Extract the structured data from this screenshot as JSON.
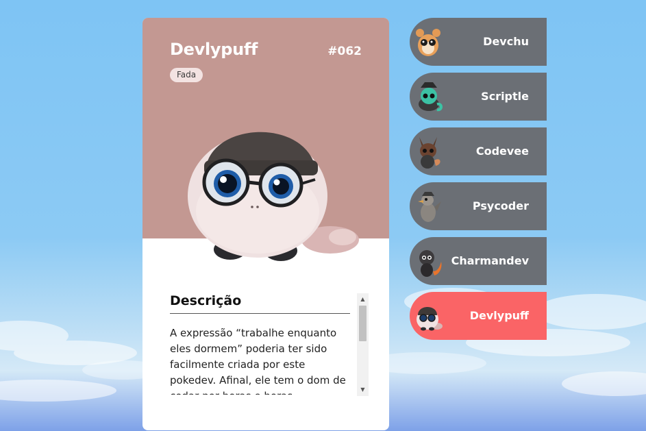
{
  "card": {
    "name": "Devlypuff",
    "number": "#062",
    "type": "Fada",
    "description_title": "Descrição",
    "description": "A expressão “trabalhe enquanto eles dormem” poderia ter sido facilmente criada por este pokedev. Afinal, ele tem o dom de codar por horas e horas.",
    "background_color": "#c39892"
  },
  "list": {
    "items": [
      {
        "label": "Devchu",
        "icon": "hamster-icon",
        "active": false
      },
      {
        "label": "Scriptle",
        "icon": "turtle-icon",
        "active": false
      },
      {
        "label": "Codevee",
        "icon": "fox-icon",
        "active": false
      },
      {
        "label": "Psycoder",
        "icon": "duck-icon",
        "active": false
      },
      {
        "label": "Charmandev",
        "icon": "lizard-icon",
        "active": false
      },
      {
        "label": "Devlypuff",
        "icon": "puff-icon",
        "active": true
      }
    ],
    "item_color": "#6b6f75",
    "active_color": "#fa6466"
  }
}
